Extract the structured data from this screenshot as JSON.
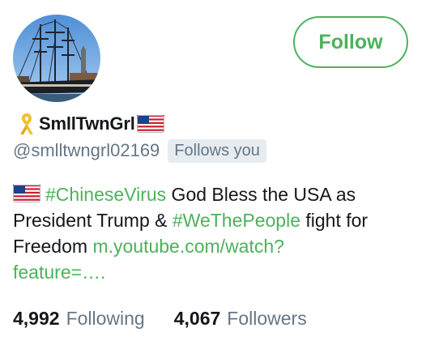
{
  "follow_button": {
    "label": "Follow"
  },
  "profile": {
    "display_name": "SmllTwnGrl",
    "name_prefix_icon": "yellow-ribbon-icon",
    "name_suffix_icon": "us-flag-icon",
    "handle": "@smlltwngrl02169",
    "follows_you_badge": "Follows you"
  },
  "bio": {
    "leading_icon": "us-flag-icon",
    "hashtag_1": "#ChineseVirus",
    "text_1": " God Bless the USA as President Trump & ",
    "hashtag_2": "#WeThePeople",
    "text_2": " fight for Freedom ",
    "link": "m.youtube.com/watch?feature=….",
    "link_line_1": "m.youtube.com/watch?",
    "link_line_2": "feature=….",
    "trailing": ""
  },
  "stats": {
    "following_count": "4,992",
    "following_label": "Following",
    "followers_count": "4,067",
    "followers_label": "Followers"
  },
  "colors": {
    "accent": "#4cb25b",
    "text": "#14171a",
    "muted": "#657786",
    "badge_bg": "#e6ecf0"
  }
}
